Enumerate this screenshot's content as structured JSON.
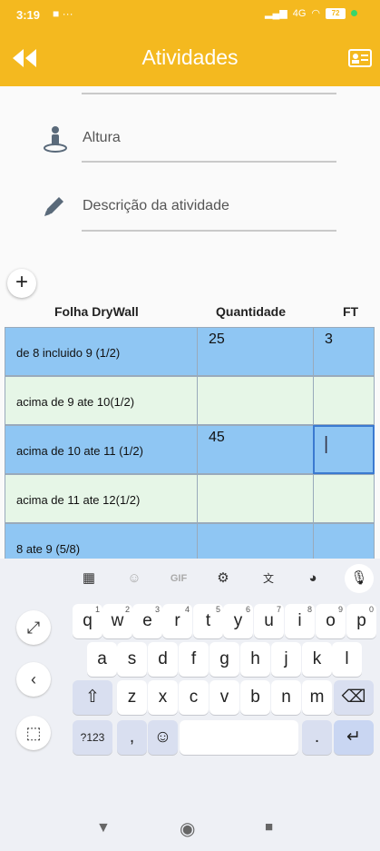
{
  "status_bar": {
    "time": "3:19",
    "icons": "■ ···",
    "network": "4G",
    "battery": "72"
  },
  "app_bar": {
    "title": "Atividades",
    "back_icon": "double-chevron-left-icon",
    "contact_icon": "contact-card-icon"
  },
  "form": {
    "height_label": "Altura",
    "description_label": "Descrição da atividade",
    "add_button": "+"
  },
  "table": {
    "headers": [
      "Folha DryWall",
      "Quantidade",
      "FT"
    ],
    "rows": [
      {
        "name": "de 8 incluido 9  (1/2)",
        "qty": "25",
        "ft": "3"
      },
      {
        "name": "acima de 9 ate 10(1/2)",
        "qty": "",
        "ft": ""
      },
      {
        "name": "acima de 10 ate 11 (1/2)",
        "qty": "45",
        "ft": "|"
      },
      {
        "name": "acima de 11 ate 12(1/2)",
        "qty": "",
        "ft": ""
      },
      {
        "name": "8 ate 9 (5/8)",
        "qty": "",
        "ft": ""
      }
    ]
  },
  "keyboard": {
    "toolbar": [
      "apps-icon",
      "sticker-icon",
      "GIF",
      "settings-icon",
      "translate-icon",
      "palette-icon",
      "mic-icon"
    ],
    "toolbar_gif": "GIF",
    "row1": [
      "q",
      "w",
      "e",
      "r",
      "t",
      "y",
      "u",
      "i",
      "o",
      "p"
    ],
    "row1_hints": [
      "1",
      "2",
      "3",
      "4",
      "5",
      "6",
      "7",
      "8",
      "9",
      "0"
    ],
    "row2": [
      "a",
      "s",
      "d",
      "f",
      "g",
      "h",
      "j",
      "k",
      "l"
    ],
    "row3": [
      "z",
      "x",
      "c",
      "v",
      "b",
      "n",
      "m"
    ],
    "shift": "⇧",
    "backspace": "⌫",
    "numbers": "?123",
    "comma": ",",
    "emoji": "☺",
    "period": ".",
    "enter": "↵",
    "side": {
      "expand": "⤢",
      "back": "‹",
      "select": "⬚"
    }
  },
  "nav": {
    "back": "▼",
    "home": "◉",
    "recents": "■"
  }
}
